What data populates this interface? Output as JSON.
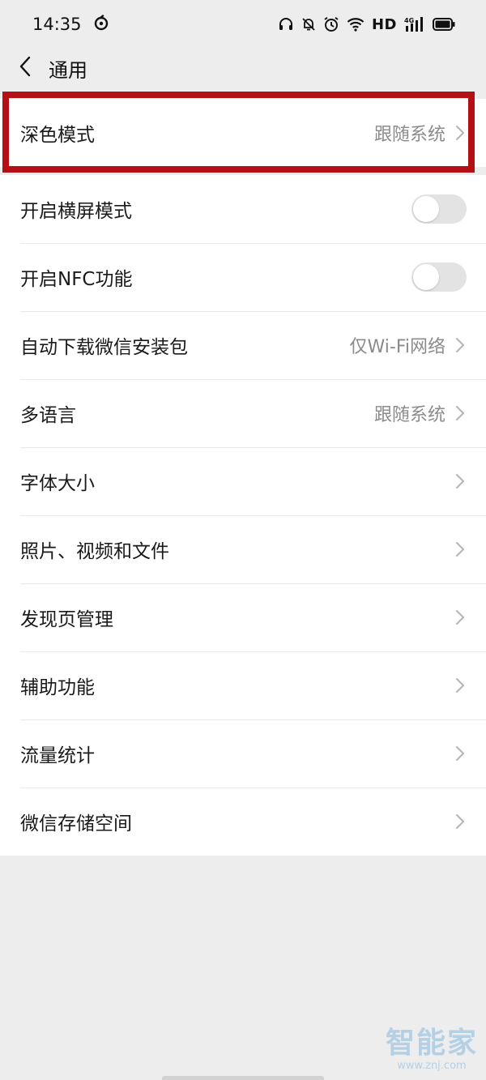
{
  "status": {
    "time": "14:35",
    "hd": "HD",
    "network": "4G"
  },
  "nav": {
    "title": "通用"
  },
  "top_group": {
    "label": "深色模式",
    "value": "跟随系统"
  },
  "rows": [
    {
      "label": "开启横屏模式",
      "type": "toggle",
      "on": false
    },
    {
      "label": "开启NFC功能",
      "type": "toggle",
      "on": false
    },
    {
      "label": "自动下载微信安装包",
      "value": "仅Wi-Fi网络",
      "type": "nav"
    },
    {
      "label": "多语言",
      "value": "跟随系统",
      "type": "nav"
    },
    {
      "label": "字体大小",
      "type": "nav"
    },
    {
      "label": "照片、视频和文件",
      "type": "nav"
    },
    {
      "label": "发现页管理",
      "type": "nav"
    },
    {
      "label": "辅助功能",
      "type": "nav"
    },
    {
      "label": "流量统计",
      "type": "nav"
    },
    {
      "label": "微信存储空间",
      "type": "nav"
    }
  ],
  "watermark": {
    "brand": "智能家",
    "url": "www.znj.com"
  },
  "colors": {
    "background": "#ededed",
    "highlight": "#b30f14",
    "toggle_off": "#e3e3e3"
  }
}
